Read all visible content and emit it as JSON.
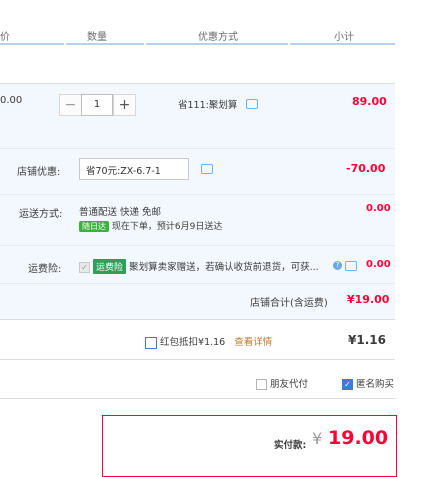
{
  "header": {
    "col_price": "价",
    "col_quantity": "数量",
    "col_promotion": "优惠方式",
    "col_subtotal": "小计"
  },
  "item": {
    "price": "0.00",
    "quantity": "1",
    "minus": "−",
    "plus": "+",
    "promotion": "省111:聚划算",
    "subtotal": "89.00"
  },
  "shop_discount": {
    "label": "店铺优惠:",
    "selected": "省70元:ZX-6.7-1",
    "amount": "-70.00"
  },
  "shipping": {
    "label": "运送方式:",
    "method": "普通配送 快递 免邮",
    "badge": "随日达",
    "note": "现在下单，预计6月9日送达",
    "amount": "0.00"
  },
  "freight_insurance": {
    "label": "运费险:",
    "badge": "运费险",
    "text": "聚划算卖家赠送，若确认收货前退货，可获...",
    "amount": "0.00"
  },
  "shop_total": {
    "label": "店铺合计(含运费)",
    "amount": "¥19.00"
  },
  "red_packet": {
    "label": "红包抵扣¥1.16",
    "link": "查看详情",
    "amount": "¥1.16"
  },
  "options": {
    "friend_pay": "朋友代付",
    "anonymous": "匿名购买"
  },
  "payment": {
    "label": "实付款:",
    "currency": "¥",
    "amount": "19.00"
  },
  "colors": {
    "accent_red": "#ff0036",
    "panel_bg": "#f3f8fe",
    "header_line": "#b7d1ea",
    "link_orange": "#c5782c",
    "check_blue": "#3c7ae0"
  }
}
